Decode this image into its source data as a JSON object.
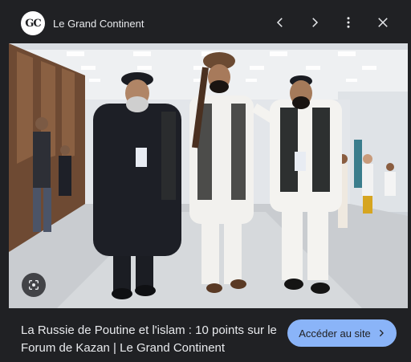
{
  "header": {
    "logo_text": "GC",
    "site_name": "Le Grand Continent",
    "icons": [
      "chevron-left-icon",
      "chevron-right-icon",
      "more-vert-icon",
      "close-icon"
    ]
  },
  "image": {
    "description_icon": "google-lens-icon"
  },
  "footer": {
    "title": "La Russie de Poutine et l'islam : 10 points sur le Forum de Kazan | Le Grand Continent",
    "visit_label": "Accéder au site",
    "visit_icon": "chevron-right-icon"
  },
  "colors": {
    "background": "#202124",
    "accent": "#8ab4f8",
    "text": "#e8eaed"
  }
}
